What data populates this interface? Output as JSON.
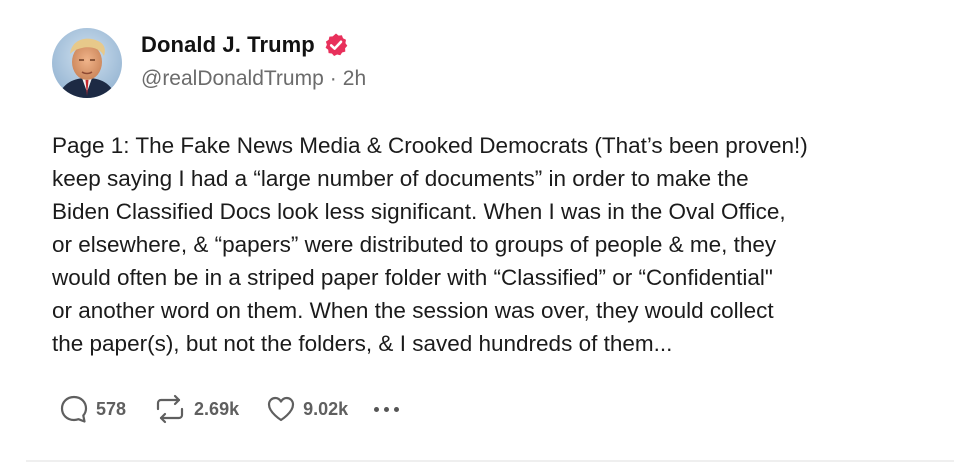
{
  "author": {
    "name": "Donald J. Trump",
    "handle": "@realDonaldTrump",
    "separator": "·",
    "time": "2h",
    "verified_color": "#e8305b"
  },
  "post": {
    "lines": [
      "Page 1: The Fake News Media & Crooked Democrats (That’s been proven!)",
      "keep saying I had a “large number of documents” in order to make the",
      "Biden Classified Docs look less significant. When I was in the Oval Office,",
      "or elsewhere, & “papers” were distributed to groups of people & me, they",
      "would often be in a striped paper folder with “Classified” or “Confidential\"",
      "or another word on them. When the session was over, they would collect",
      "the paper(s), but not the folders, & I saved hundreds of them..."
    ]
  },
  "actions": {
    "replies": "578",
    "retruths": "2.69k",
    "likes": "9.02k",
    "icons": [
      "reply-icon",
      "retruth-icon",
      "heart-icon",
      "more-icon"
    ]
  }
}
